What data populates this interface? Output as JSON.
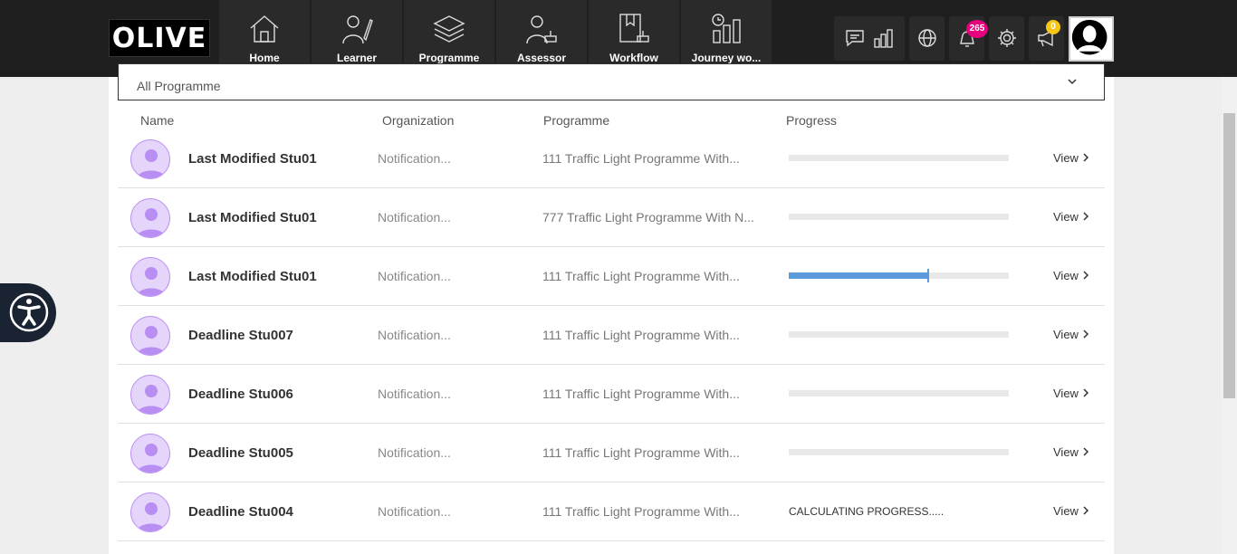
{
  "brand": {
    "logo": "OLIVE"
  },
  "nav": [
    {
      "label": "Home",
      "icon": "home-icon"
    },
    {
      "label": "Learner",
      "icon": "learner-icon"
    },
    {
      "label": "Programme",
      "icon": "programme-icon"
    },
    {
      "label": "Assessor",
      "icon": "assessor-icon"
    },
    {
      "label": "Workflow",
      "icon": "workflow-icon"
    },
    {
      "label": "Journey wo...",
      "icon": "journey-icon"
    }
  ],
  "header_icons": {
    "notifications_badge": "265",
    "announcements_badge": "0"
  },
  "filter": {
    "programme": "All Programme"
  },
  "columns": {
    "name": "Name",
    "organization": "Organization",
    "programme": "Programme",
    "progress": "Progress"
  },
  "rows": [
    {
      "name": "Last Modified Stu01",
      "organization": "Notification...",
      "programme": "111 Traffic Light Programme With...",
      "progress": 0,
      "view": "View"
    },
    {
      "name": "Last Modified Stu01",
      "organization": "Notification...",
      "programme": "777 Traffic Light Programme With N...",
      "progress": 0,
      "view": "View"
    },
    {
      "name": "Last Modified Stu01",
      "organization": "Notification...",
      "programme": "111 Traffic Light Programme With...",
      "progress": 0.63,
      "view": "View"
    },
    {
      "name": "Deadline Stu007",
      "organization": "Notification...",
      "programme": "111 Traffic Light Programme With...",
      "progress": 0,
      "view": "View"
    },
    {
      "name": "Deadline Stu006",
      "organization": "Notification...",
      "programme": "111 Traffic Light Programme With...",
      "progress": 0,
      "view": "View"
    },
    {
      "name": "Deadline Stu005",
      "organization": "Notification...",
      "programme": "111 Traffic Light Programme With...",
      "progress": 0,
      "view": "View"
    },
    {
      "name": "Deadline Stu004",
      "organization": "Notification...",
      "programme": "111 Traffic Light Programme With...",
      "progress_text": "CALCULATING PROGRESS.....",
      "view": "View"
    }
  ],
  "colors": {
    "topbar": "#1f1f1f",
    "progress_fill": "#5b9bdc",
    "avatar_purple": "#b98ef2",
    "badge_pink": "#e6007e",
    "badge_yellow": "#f5c518"
  }
}
